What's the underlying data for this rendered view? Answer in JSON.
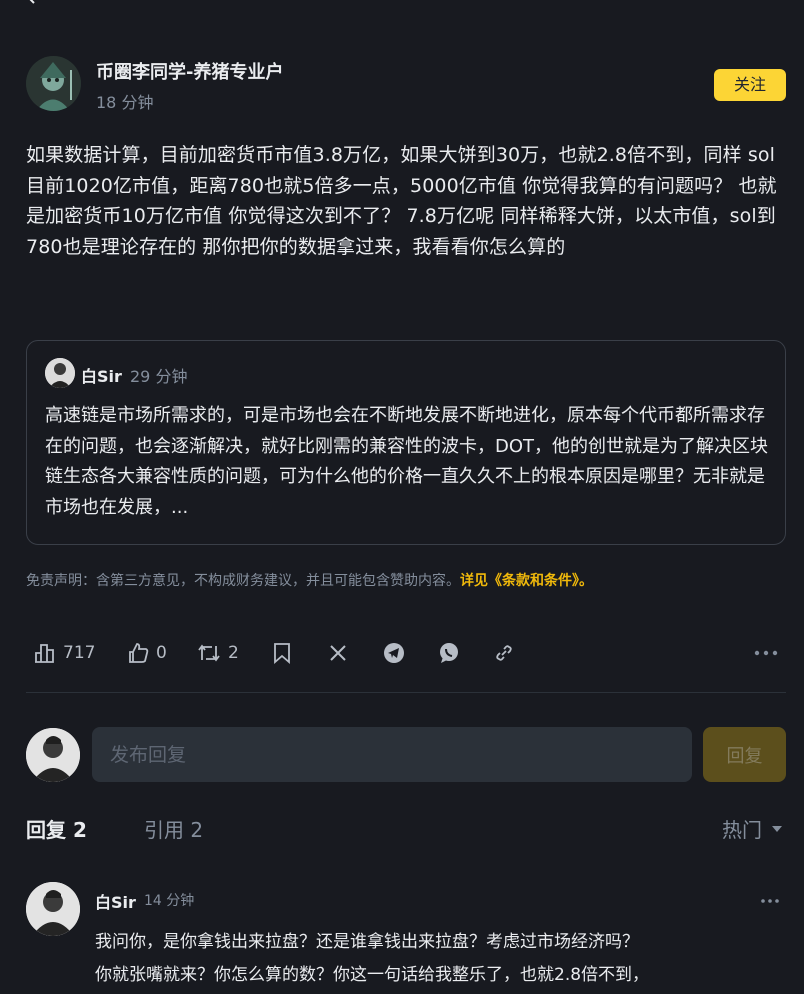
{
  "post": {
    "author": "币圈李同学-养猪专业户",
    "time": "18 分钟",
    "follow_label": "关注",
    "body": "如果数据计算，目前加密货币市值3.8万亿，如果大饼到30万，也就2.8倍不到，同样 sol目前1020亿市值，距离780也就5倍多一点，5000亿市值 你觉得我算的有问题吗？ 也就是加密货币10万亿市值 你觉得这次到不了？ 7.8万亿呢 同样稀释大饼，以太市值，sol到780也是理论存在的 那你把你的数据拿过来，我看看你怎么算的"
  },
  "quote": {
    "author": "白Sir",
    "time": "29 分钟",
    "body": "高速链是市场所需求的，可是市场也会在不断地发展不断地进化，原本每个代币都所需求存在的问题，也会逐渐解决，就好比刚需的兼容性的波卡，DOT，他的创世就是为了解决区块链生态各大兼容性质的问题，可为什么他的价格一直久久不上的根本原因是哪里？无非就是市场也在发展，..."
  },
  "disclaimer": {
    "text": "免责声明：含第三方意见，不构成财务建议，并且可能包含赞助内容。",
    "link": "详见《条款和条件》。"
  },
  "actions": {
    "views": "717",
    "likes": "0",
    "reposts": "2",
    "icons": [
      "views-icon",
      "like-icon",
      "repost-icon",
      "bookmark-icon",
      "x-share-icon",
      "telegram-icon",
      "whatsapp-icon",
      "link-icon",
      "more-icon"
    ]
  },
  "reply_box": {
    "placeholder": "发布回复",
    "button": "回复"
  },
  "tabs": {
    "replies": "回复 2",
    "quotes": "引用 2",
    "sort": "热门"
  },
  "comments": [
    {
      "author": "白Sir",
      "time": "14 分钟",
      "line1": "我问你，是你拿钱出来拉盘？还是谁拿钱出来拉盘？考虑过市场经济吗？",
      "line2": "你就张嘴就来？你怎么算的数？你这一句话给我整乐了，也就2.8倍不到，"
    }
  ],
  "colors": {
    "background": "#181a20",
    "accent": "#fcd535",
    "muted": "#848e9c",
    "terms_link": "#f0b90b"
  }
}
